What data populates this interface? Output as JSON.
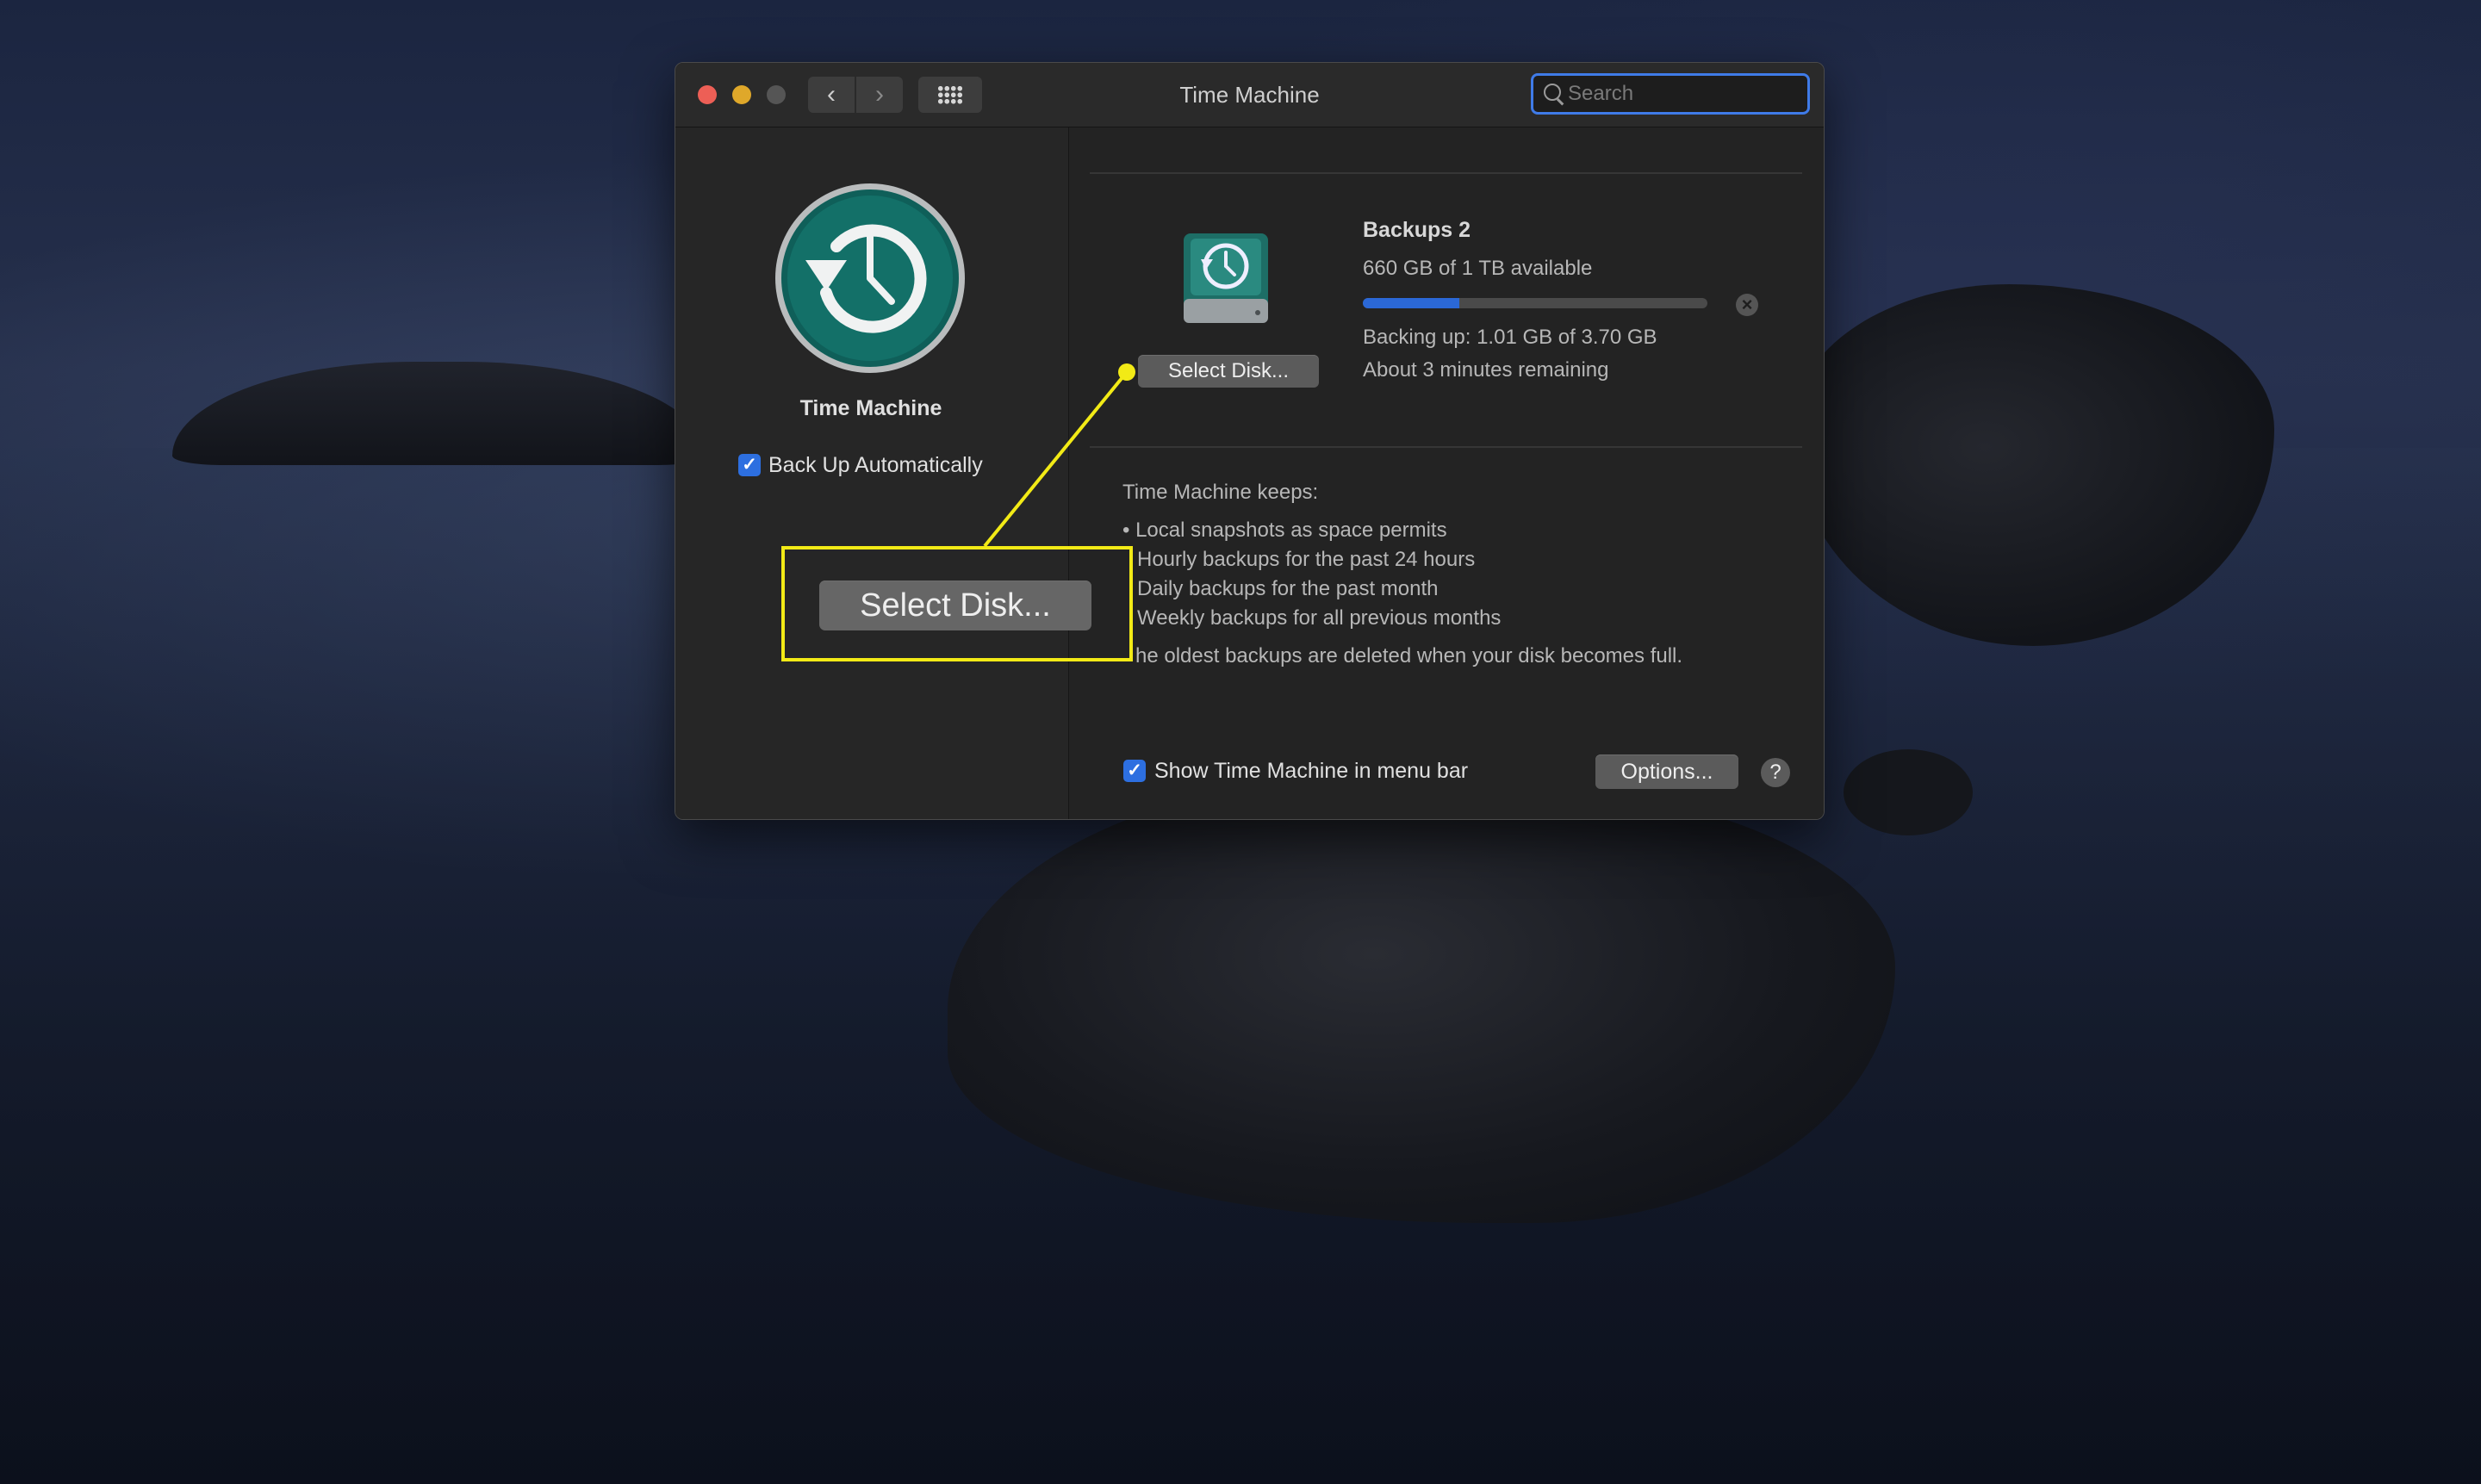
{
  "window": {
    "title": "Time Machine",
    "search_placeholder": "Search"
  },
  "sidebar": {
    "app_name": "Time Machine",
    "backup_automatically_label": "Back Up Automatically",
    "backup_automatically_checked": true
  },
  "disk": {
    "name": "Backups 2",
    "availability": "660 GB of 1 TB available",
    "progress_fraction": 0.28,
    "status": "Backing up: 1.01 GB of 3.70 GB",
    "remaining": "About 3 minutes remaining",
    "select_disk_label": "Select Disk..."
  },
  "info": {
    "heading": "Time Machine keeps:",
    "items": [
      "Local snapshots as space permits",
      "Hourly backups for the past 24 hours",
      "Daily backups for the past month",
      "Weekly backups for all previous months"
    ],
    "footer": "he oldest backups are deleted when your disk becomes full."
  },
  "footer": {
    "show_in_menu_bar_label": "Show Time Machine in menu bar",
    "show_in_menu_bar_checked": true,
    "options_label": "Options...",
    "help_label": "?"
  },
  "callout": {
    "label": "Select Disk...",
    "color": "#f2ea16"
  },
  "colors": {
    "accent": "#2d6fe0",
    "close": "#ed5f56",
    "minimize": "#dfa82a"
  }
}
